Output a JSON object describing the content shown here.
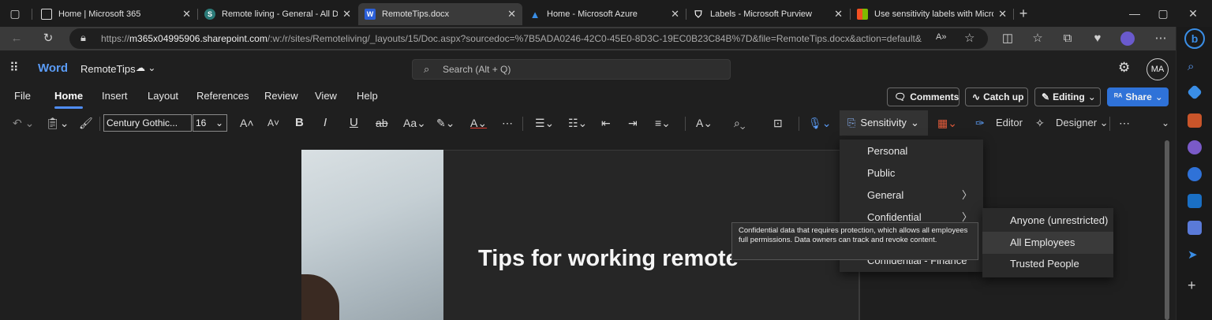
{
  "browser": {
    "tabs": [
      {
        "label": "Home | Microsoft 365",
        "favicon_color": "#ffffff",
        "favicon": "page-icon",
        "active": false
      },
      {
        "label": "Remote living - General - All Doc",
        "favicon_color": "#2b7a78",
        "favicon": "sharepoint-icon",
        "active": false
      },
      {
        "label": "RemoteTips.docx",
        "favicon_color": "#2b5fd8",
        "favicon": "word-icon",
        "active": true
      },
      {
        "label": "Home - Microsoft Azure",
        "favicon_color": "#3a8ee6",
        "favicon": "azure-icon",
        "active": false
      },
      {
        "label": "Labels - Microsoft Purview",
        "favicon_color": "#ffffff",
        "favicon": "shield-icon",
        "active": false
      },
      {
        "label": "Use sensitivity labels with Micros",
        "favicon_color": "#f25022",
        "favicon": "microsoft-icon",
        "active": false
      }
    ],
    "url_prefix": "https://",
    "url_host": "m365x04995906.sharepoint.com",
    "url_path": "/:w:/r/sites/Remoteliving/_layouts/15/Doc.aspx?sourcedoc=%7B5ADA0246-42C0-45E0-8D3C-19EC0B23C84B%7D&file=RemoteTips.docx&action=default&..."
  },
  "app": {
    "name": "Word",
    "doc_name": "RemoteTips",
    "search_placeholder": "Search (Alt + Q)",
    "avatar": "MA"
  },
  "menu_tabs": [
    "File",
    "Home",
    "Insert",
    "Layout",
    "References",
    "Review",
    "View",
    "Help"
  ],
  "actions": {
    "comments": "Comments",
    "catchup": "Catch up",
    "editing": "Editing",
    "share": "Share"
  },
  "ribbon": {
    "font_name": "Century Gothic...",
    "font_size": "16",
    "sensitivity": "Sensitivity",
    "editor": "Editor",
    "designer": "Designer"
  },
  "document": {
    "title": "Tips for working remote"
  },
  "sensitivity_menu": {
    "items": [
      {
        "label": "Personal",
        "has_sub": false
      },
      {
        "label": "Public",
        "has_sub": false
      },
      {
        "label": "General",
        "has_sub": true
      },
      {
        "label": "Confidential",
        "has_sub": true
      },
      {
        "label": "Confidential - Finance",
        "has_sub": false
      }
    ],
    "submenu": [
      "Anyone (unrestricted)",
      "All Employees",
      "Trusted People"
    ],
    "tooltip": "Confidential data that requires protection, which allows all employees full permissions. Data owners can track and revoke content."
  },
  "colors": {
    "accent": "#2f72d8",
    "highlight_yellow": "#f2e600",
    "font_red": "#e03a2f"
  }
}
